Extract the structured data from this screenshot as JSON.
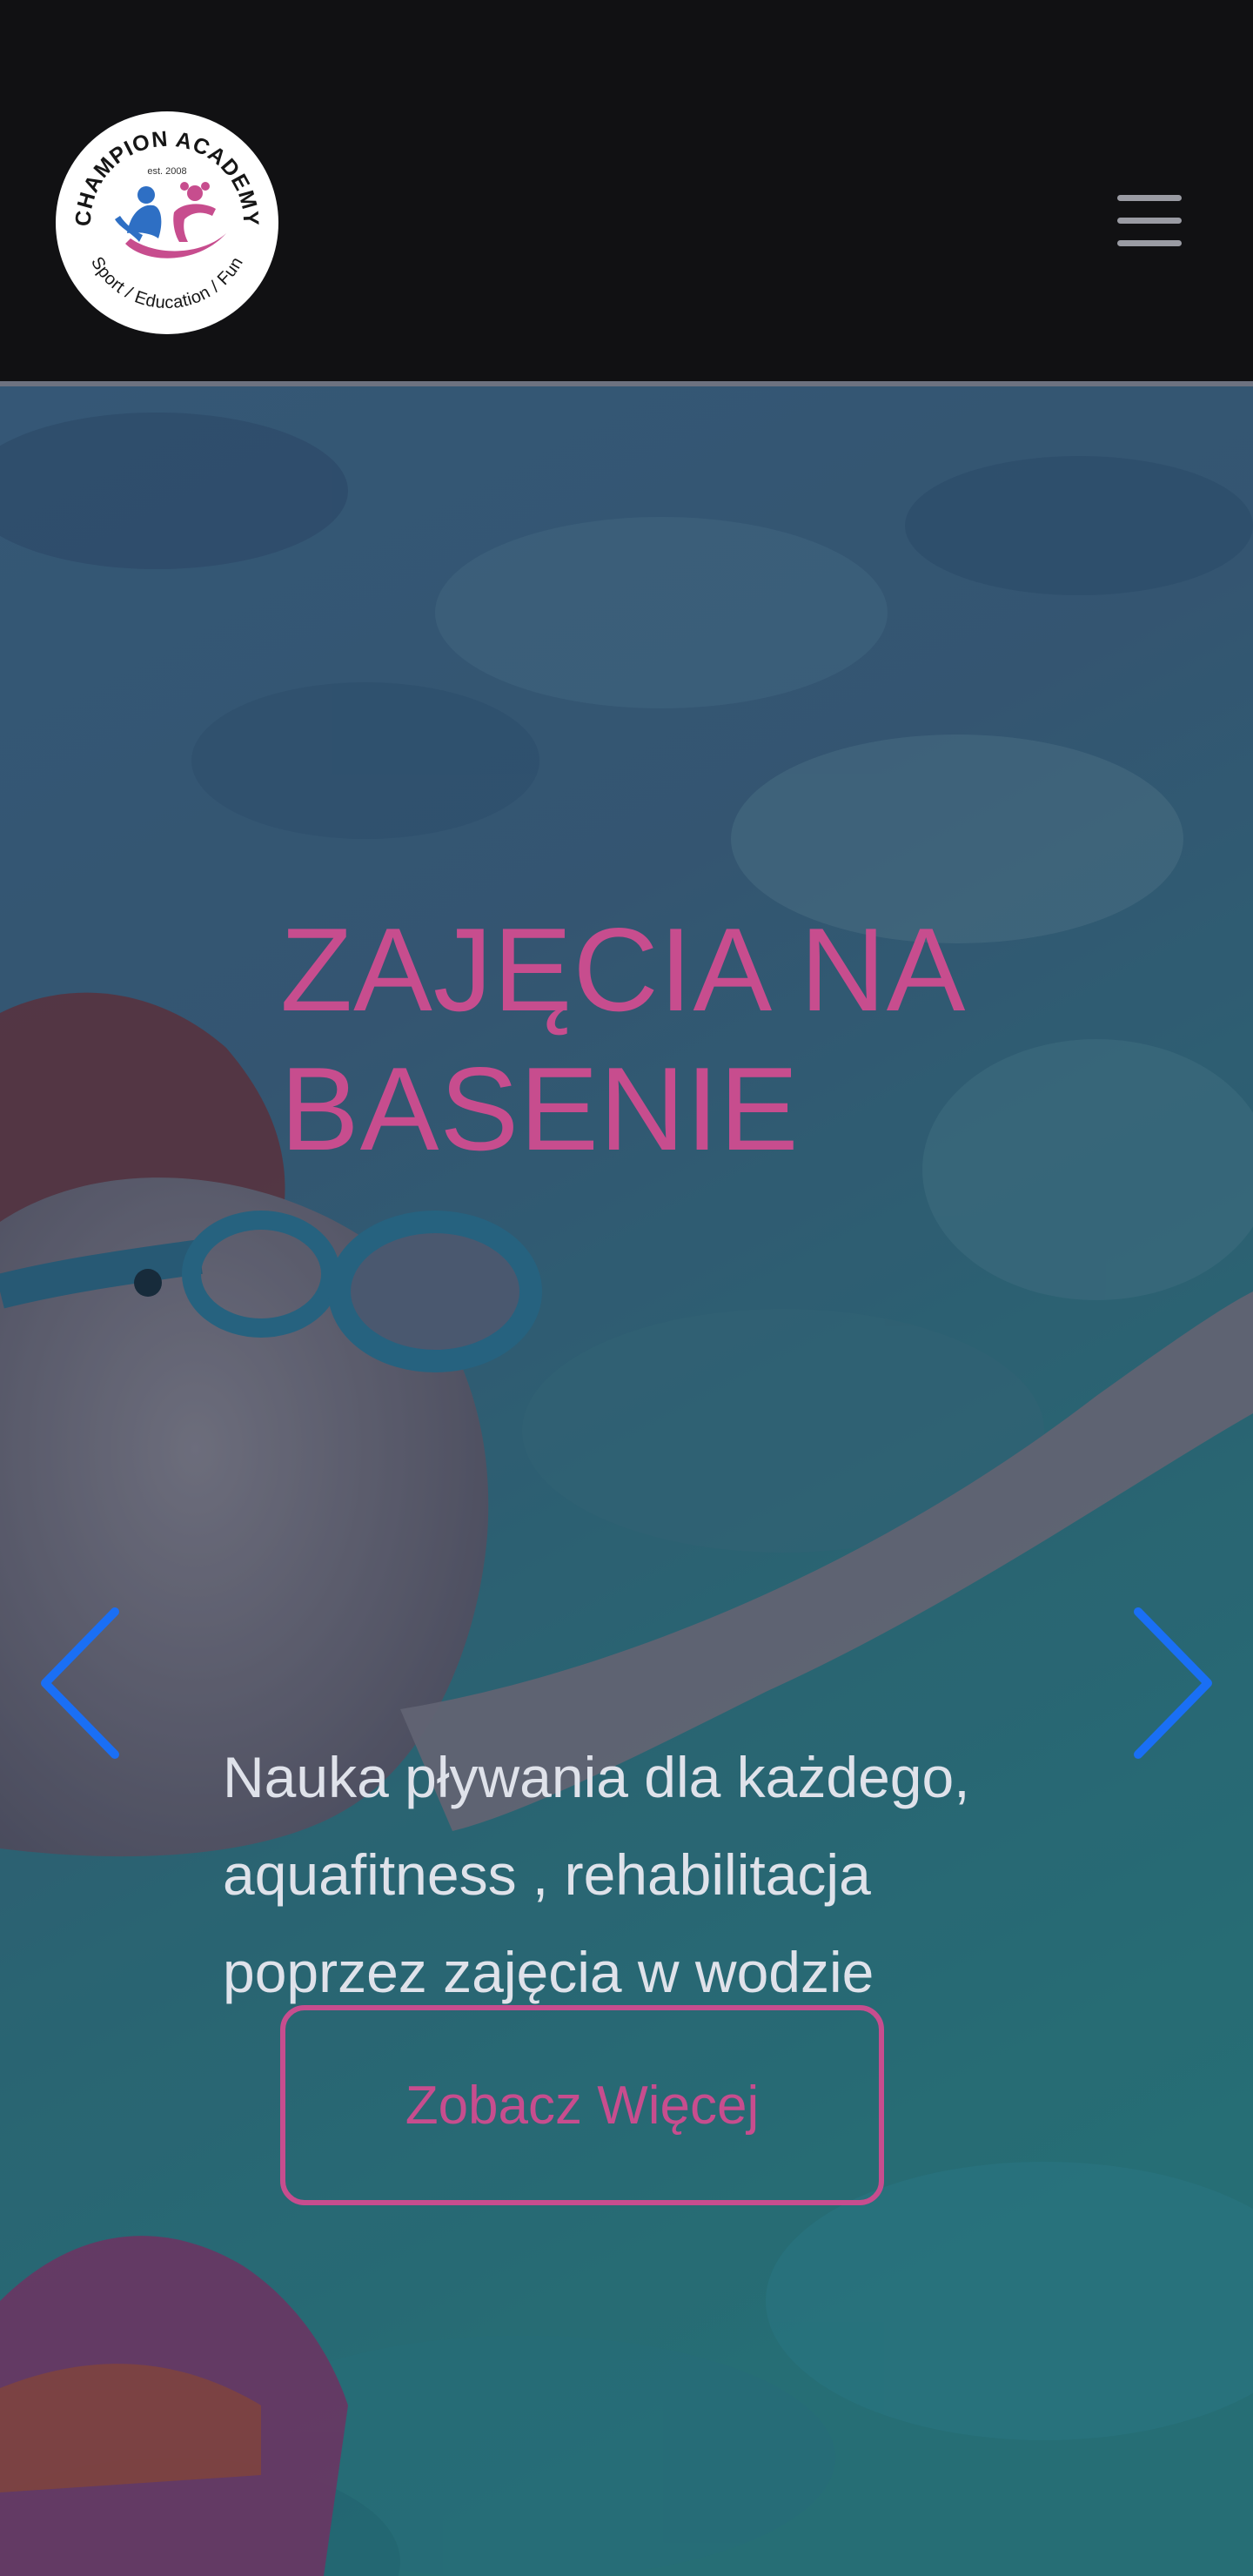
{
  "header": {
    "logo": {
      "top_text": "CHAMPION ACADEMY",
      "established": "est. 2008",
      "bottom_text": "Sport / Education / Fun"
    },
    "menu_icon": "hamburger-menu-icon"
  },
  "hero": {
    "title_line1": "ZAJĘCIA NA",
    "title_line2": "BASENIE",
    "description": "Nauka pływania dla każdego, aquafitness , rehabilitacja poprzez zajęcia w wodzie",
    "cta_label": "Zobacz Więcej",
    "prev_icon": "chevron-left-icon",
    "next_icon": "chevron-right-icon"
  },
  "colors": {
    "accent_pink": "#c74d8e",
    "carousel_arrow_blue": "#1a6ff5",
    "header_bg": "#111113"
  }
}
